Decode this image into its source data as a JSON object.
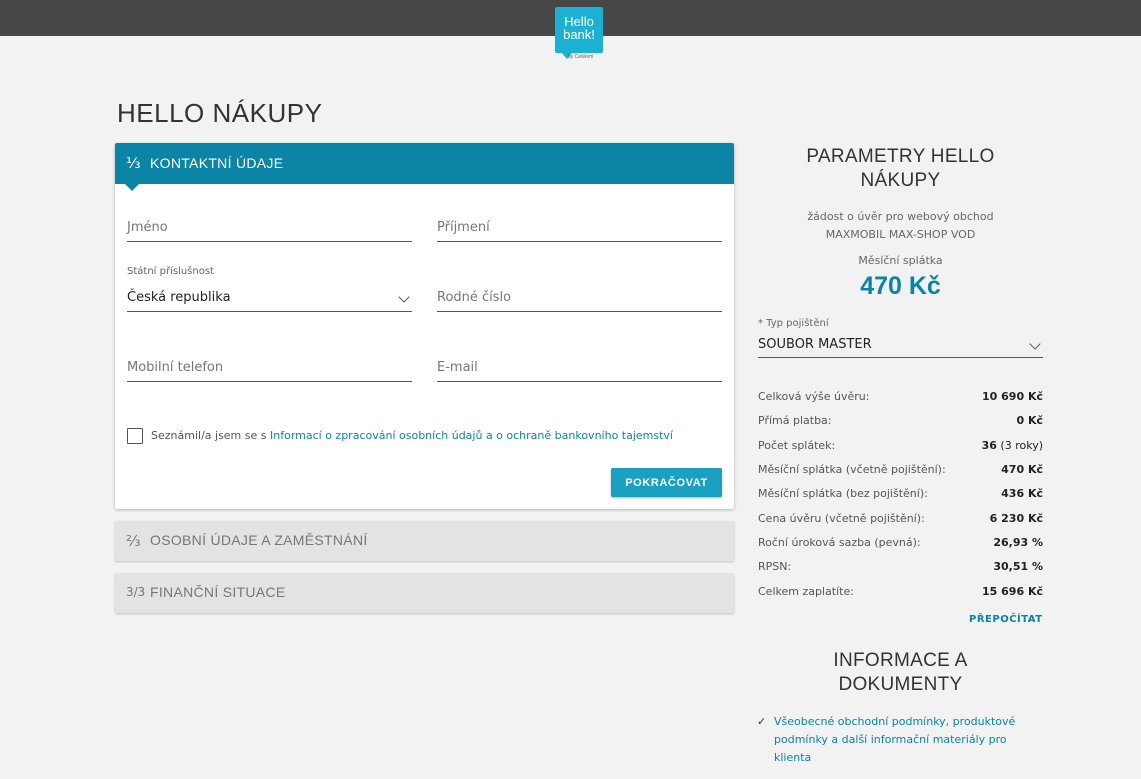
{
  "brand": {
    "logo_line1": "Hello",
    "logo_line2": "bank!",
    "logo_sub": "by Cetelem"
  },
  "page": {
    "title": "HELLO NÁKUPY"
  },
  "form": {
    "step1": {
      "step": "⅓",
      "title": "KONTAKTNÍ ÚDAJE"
    },
    "fields": {
      "first_name": "Jméno",
      "last_name": "Příjmení",
      "nationality_label": "Státní příslušnost",
      "nationality_value": "Česká republika",
      "birth_number": "Rodné číslo",
      "mobile": "Mobilní telefon",
      "email": "E-mail"
    },
    "consent_prefix": "Seznámil/a jsem se s ",
    "consent_link": "Informací o zpracování osobních údajů a o ochraně bankovního tajemství",
    "continue": "POKRAČOVAT",
    "step2": {
      "step": "⅔",
      "title": "OSOBNÍ ÚDAJE A ZAMĚSTNÁNÍ"
    },
    "step3": {
      "step": "3/3",
      "title": "FINANČNÍ SITUACE"
    }
  },
  "params": {
    "title_line1": "PARAMETRY HELLO",
    "title_line2": "NÁKUPY",
    "request_line1": "žádost o úvěr pro webový obchod",
    "request_line2": "MAXMOBIL MAX-SHOP VOD",
    "monthly_label": "Měsíční splátka",
    "monthly_amount": "470 Kč",
    "insurance_label": "* Typ pojištění",
    "insurance_value": "SOUBOR MASTER",
    "rows": [
      {
        "k": "Celková výše úvěru:",
        "v": "10 690 Kč",
        "note": ""
      },
      {
        "k": "Přímá platba:",
        "v": "0 Kč",
        "note": ""
      },
      {
        "k": "Počet splátek:",
        "v": "36",
        "note": " (3 roky)"
      },
      {
        "k": "Měsíční splátka (včetně pojištění):",
        "v": "470 Kč",
        "note": ""
      },
      {
        "k": "Měsíční splátka (bez pojištění):",
        "v": "436 Kč",
        "note": ""
      },
      {
        "k": "Cena úvěru (včetně pojištění):",
        "v": "6 230 Kč",
        "note": ""
      },
      {
        "k": "Roční úroková sazba (pevná):",
        "v": "26,93 %",
        "note": ""
      },
      {
        "k": "RPSN:",
        "v": "30,51 %",
        "note": ""
      },
      {
        "k": "Celkem zaplatíte:",
        "v": "15 696 Kč",
        "note": ""
      }
    ],
    "recalc": "PŘEPOČÍTAT"
  },
  "docs": {
    "title_line1": "INFORMACE A",
    "title_line2": "DOKUMENTY",
    "item": "Všeobecné obchodní podmínky, produktové podmínky a další informační materiály pro klienta"
  }
}
